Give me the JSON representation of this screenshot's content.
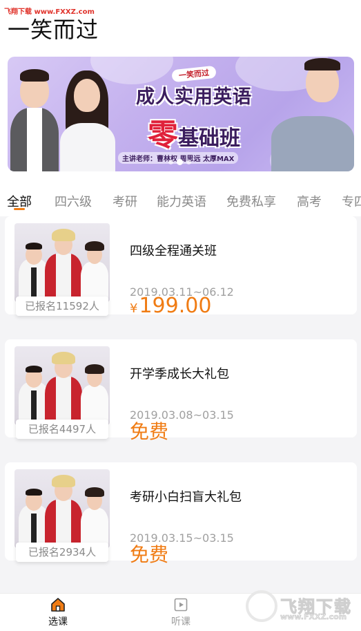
{
  "watermark_top": "飞翔下载 www.FXXZ.com",
  "app_title": "一笑而过",
  "banner": {
    "subtitle": "一笑而过",
    "line1": "成人实用英语",
    "line2_highlight": "零",
    "line2_rest": "基础班",
    "teachers": "主讲老师：曹林权 周思远 太厚MAX",
    "slide_count": 3,
    "active_slide": 1
  },
  "tabs": [
    {
      "label": "全部",
      "active": true
    },
    {
      "label": "四六级",
      "active": false
    },
    {
      "label": "考研",
      "active": false
    },
    {
      "label": "能力英语",
      "active": false
    },
    {
      "label": "免费私享",
      "active": false
    },
    {
      "label": "高考",
      "active": false
    },
    {
      "label": "专四",
      "active": false
    }
  ],
  "courses": [
    {
      "title": "四级全程通关班",
      "date": "2019.03.11~06.12",
      "price_symbol": "¥",
      "price": "199.00",
      "enrolled": "已报名11592人"
    },
    {
      "title": "开学季成长大礼包",
      "date": "2019.03.08~03.15",
      "free_label": "免费",
      "enrolled": "已报名4497人"
    },
    {
      "title": "考研小白扫盲大礼包",
      "date": "2019.03.15~03.15",
      "free_label": "免费",
      "enrolled": "已报名2934人"
    }
  ],
  "bottom_nav": [
    {
      "label": "选课",
      "icon": "home-icon",
      "active": true
    },
    {
      "label": "听课",
      "icon": "play-icon",
      "active": false
    }
  ],
  "watermark_logo": {
    "big": "飞翔下载",
    "small": "www.FXXZ.com"
  },
  "colors": {
    "accent": "#f07c14",
    "banner_bg": "#c4b1ee",
    "list_bg": "#f4f4f6"
  }
}
